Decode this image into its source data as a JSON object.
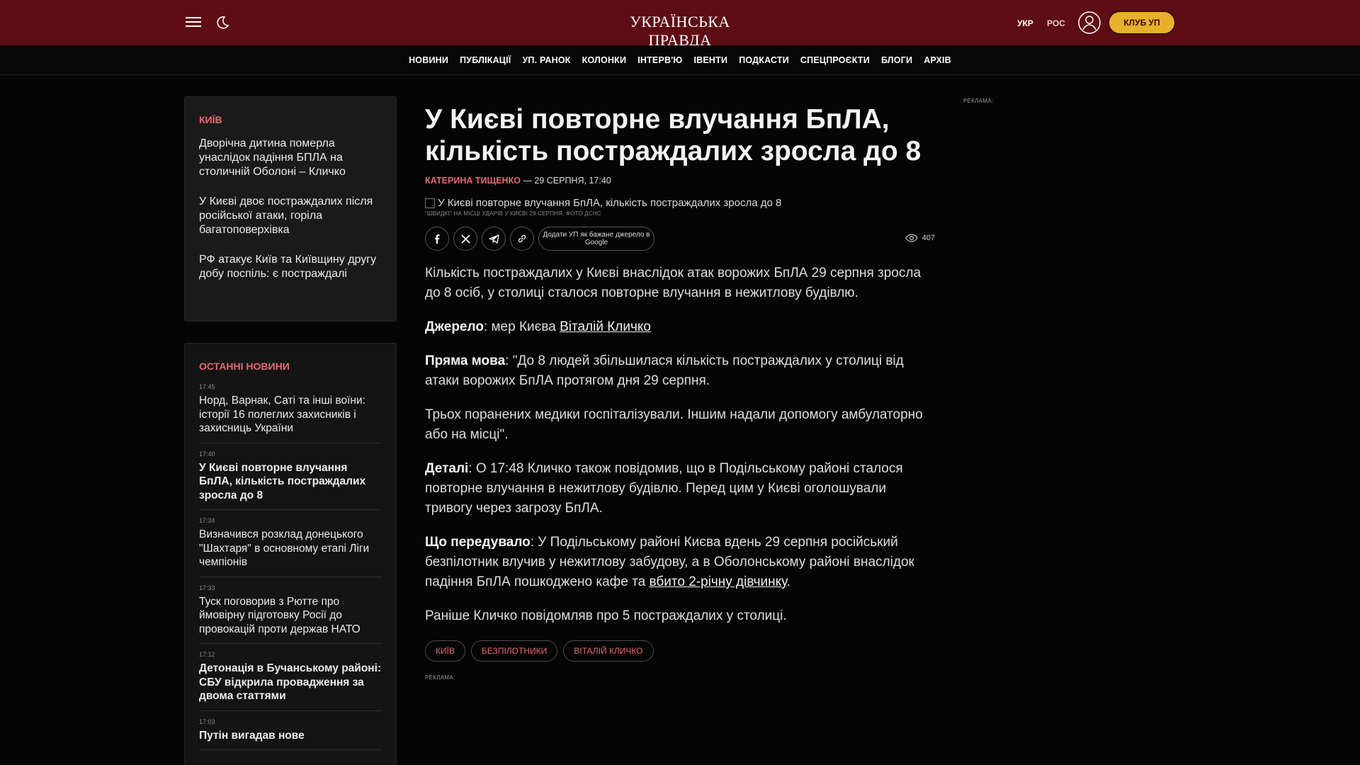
{
  "header": {
    "logo": "УКРАЇНСЬКА ПРАВДА",
    "lang_ukr": "УКР",
    "lang_ros": "РОС",
    "club_button": "КЛУБ УП"
  },
  "nav": [
    "НОВИНИ",
    "ПУБЛІКАЦІЇ",
    "УП. РАНОК",
    "КОЛОНКИ",
    "ІНТЕРВ'Ю",
    "ІВЕНТИ",
    "ПОДКАСТИ",
    "СПЕЦПРОЄКТИ",
    "БЛОГИ",
    "АРХІВ"
  ],
  "kyiv_box": {
    "label": "КИЇВ",
    "items": [
      "Дворічна дитина померла унаслідок падіння БПЛА на столичній Оболоні – Кличко",
      "У Києві двоє постраждалих після російської атаки, горіла багатоповерхівка",
      "РФ атакує Київ та Київщину другу добу поспіль: є постраждалі"
    ]
  },
  "latest_news": {
    "label": "ОСТАННІ НОВИНИ",
    "items": [
      {
        "time": "17:45",
        "title": "Норд, Варнак, Саті та інші воїни: історії 16 полеглих захисників і захисниць України",
        "bold": false
      },
      {
        "time": "17:40",
        "title": "У Києві повторне влучання БпЛА, кількість постраждалих зросла до 8",
        "bold": true
      },
      {
        "time": "17:34",
        "title": "Визначився розклад донецького \"Шахтаря\" в основному етапі Ліги чемпіонів",
        "bold": false
      },
      {
        "time": "17:33",
        "title": "Туск поговорив з Рютте про ймовірну підготовку Росії до провокацій проти держав НАТО",
        "bold": false
      },
      {
        "time": "17:12",
        "title": "Детонація в Бучанському районі: СБУ відкрила провадження за двома статтями",
        "bold": true
      },
      {
        "time": "17:03",
        "title": "Путін вигадав нове",
        "bold": true
      }
    ]
  },
  "article": {
    "headline": "У Києві повторне влучання БпЛА, кількість постраждалих зросла до 8",
    "author": "КАТЕРИНА ТИЩЕНКО",
    "date": " — 29 СЕРПНЯ, 17:40",
    "image_alt": "У Києві повторне влучання БпЛА, кількість постраждалих зросла до 8",
    "image_caption": "\"ШВИДКІ\" НА МІСЦІ УДАРІВ У КИЄВІ 29 СЕРПНЯ, ФОТО ДСНС",
    "google_button": "Додати УП як бажане джерело в Google",
    "views": "407",
    "p1": "Кількість постраждалих у Києві внаслідок атак ворожих БпЛА 29 серпня зросла до 8 осіб, у столиці сталося повторне влучання в нежитлову будівлю.",
    "p2_label": "Джерело",
    "p2_text": ": мер Києва ",
    "p2_link": "Віталій Кличко",
    "p3_label": "Пряма мова",
    "p3_text": ": \"До 8 людей збільшилася кількість постраждалих у столиці від атаки ворожих БпЛА протягом дня 29 серпня.",
    "p4": "Трьох поранених медики госпіталізували. Іншим надали допомогу амбулаторно або на місці\".",
    "p5_label": "Деталі",
    "p5_text": ": О 17:48 Кличко також повідомив, що в Подільському районі сталося повторне влучання в нежитлову будівлю. Перед цим у Києві оголошували тривогу через загрозу БпЛА.",
    "p6_label": "Що передувало",
    "p6_text": ": У Подільському районі Києва вдень 29 серпня російський безпілотник влучив у нежитлову забудову, а в Оболонському районі внаслідок падіння БпЛА пошкоджено кафе та ",
    "p6_link": "вбито 2-річну дівчинку",
    "p6_end": ".",
    "p7": "Раніше Кличко повідомляв про 5 постраждалих у столиці.",
    "tags": [
      "КИЇВ",
      "БЕЗПІЛОТНИКИ",
      "ВІТАЛІЙ КЛИЧКО"
    ],
    "ad_label": "РЕКЛАМА:"
  },
  "right_ad_label": "РЕКЛАМА:",
  "colors": {
    "header_bg": "#5e0d14",
    "accent": "#e46a73",
    "club": "#e7b12b"
  }
}
